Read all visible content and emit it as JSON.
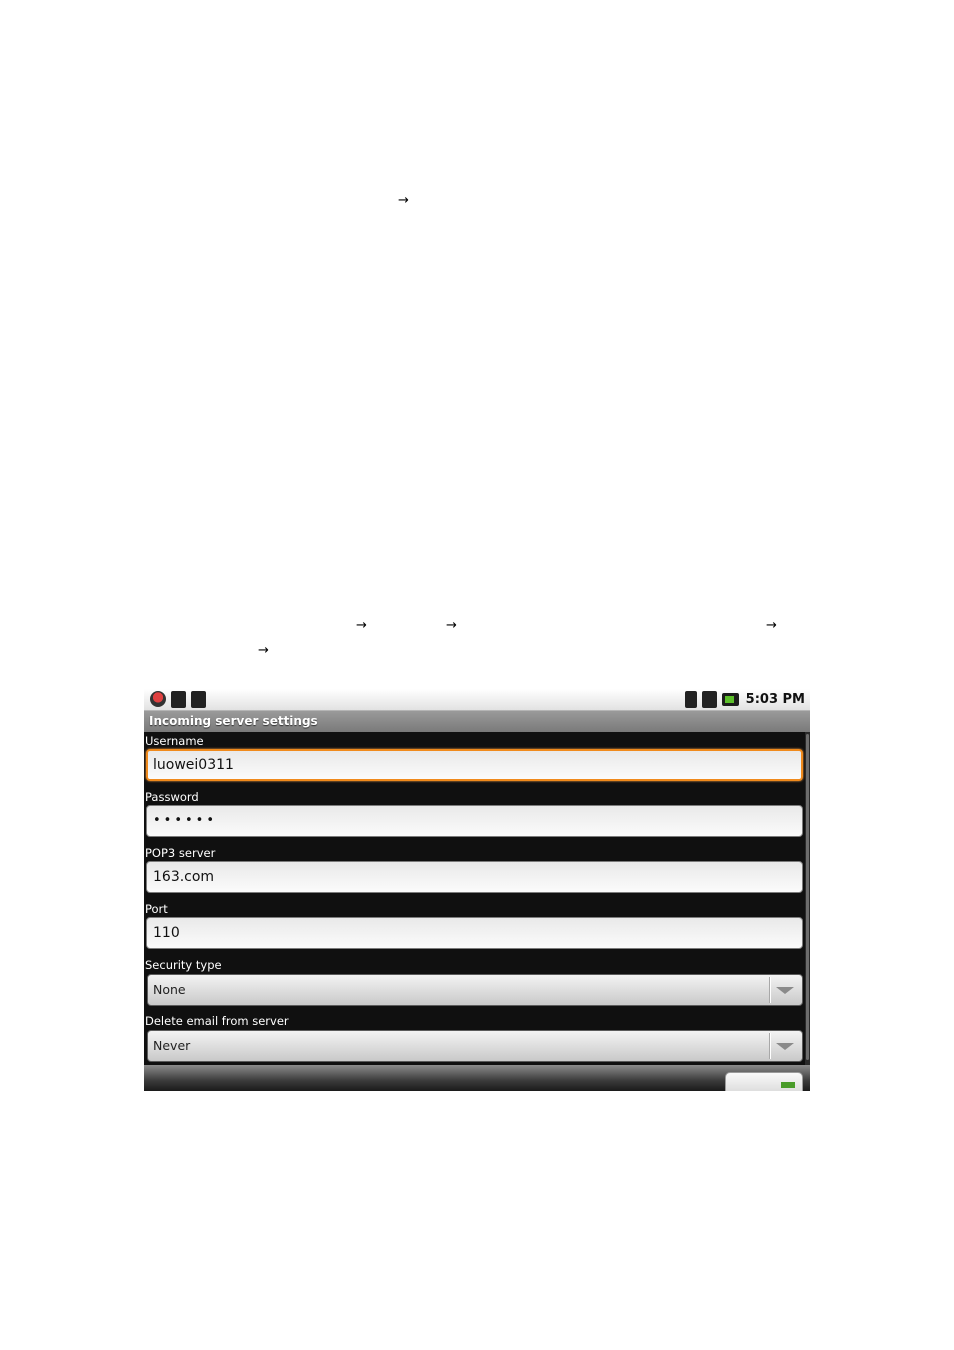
{
  "document": {
    "arrows": [
      "→",
      "→",
      "→",
      "→",
      "→"
    ]
  },
  "status_bar": {
    "left_icons": [
      "notification-icon",
      "sd-card-icon",
      "usb-icon"
    ],
    "right_icons": [
      "wifi-icon",
      "signal-icon",
      "battery-icon"
    ],
    "time": "5:03 PM"
  },
  "title": "Incoming server settings",
  "form": {
    "username": {
      "label": "Username",
      "value": "luowei0311"
    },
    "password": {
      "label": "Password",
      "value": "••••••"
    },
    "server": {
      "label": "POP3 server",
      "value": "163.com"
    },
    "port": {
      "label": "Port",
      "value": "110"
    },
    "security": {
      "label": "Security type",
      "selected": "None"
    },
    "delete": {
      "label": "Delete email from server",
      "selected": "Never"
    }
  },
  "colors": {
    "focus_border": "#f08a1c",
    "title_bar": "#8a8a8a",
    "background": "#101010"
  }
}
